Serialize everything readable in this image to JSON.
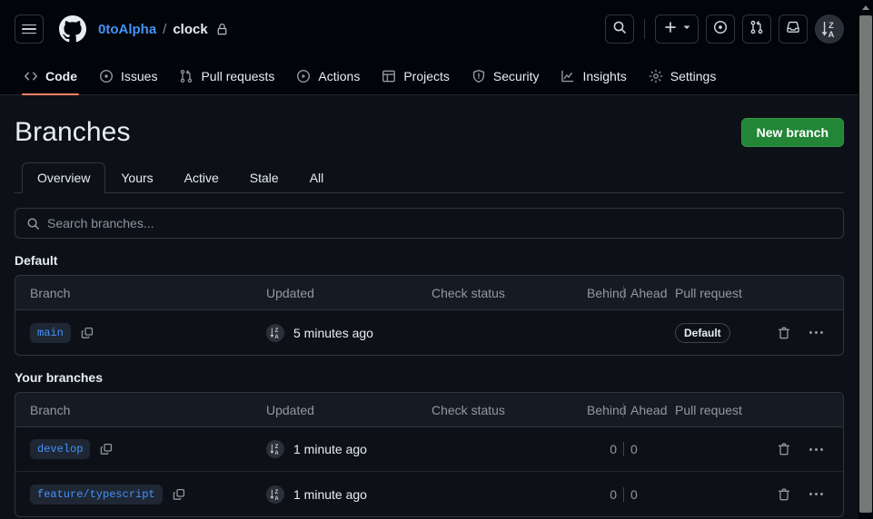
{
  "header": {
    "menu_label": "Open menu",
    "logo": "github-logo",
    "breadcrumb": {
      "owner": "0toAlpha",
      "separator": "/",
      "repo": "clock",
      "visibility_icon": "lock-icon"
    },
    "actions": [
      {
        "name": "search-button",
        "icon": "search-icon"
      },
      {
        "name": "create-new-button",
        "icon": "plus-icon",
        "caret": "chevron-down-icon"
      },
      {
        "name": "issues-button",
        "icon": "issue-opened-icon"
      },
      {
        "name": "pull-requests-button",
        "icon": "git-pull-request-icon"
      },
      {
        "name": "notifications-button",
        "icon": "inbox-icon"
      },
      {
        "name": "user-avatar",
        "icon": "sort-za-icon"
      }
    ]
  },
  "repo_nav": {
    "items": [
      {
        "label": "Code",
        "icon": "code-icon",
        "active": true
      },
      {
        "label": "Issues",
        "icon": "issue-opened-icon",
        "active": false
      },
      {
        "label": "Pull requests",
        "icon": "git-pull-request-icon",
        "active": false
      },
      {
        "label": "Actions",
        "icon": "play-icon",
        "active": false
      },
      {
        "label": "Projects",
        "icon": "table-icon",
        "active": false
      },
      {
        "label": "Security",
        "icon": "shield-icon",
        "active": false
      },
      {
        "label": "Insights",
        "icon": "graph-icon",
        "active": false
      },
      {
        "label": "Settings",
        "icon": "gear-icon",
        "active": false
      }
    ]
  },
  "main": {
    "title": "Branches",
    "new_branch_label": "New branch",
    "tabs": [
      {
        "label": "Overview",
        "selected": true
      },
      {
        "label": "Yours",
        "selected": false
      },
      {
        "label": "Active",
        "selected": false
      },
      {
        "label": "Stale",
        "selected": false
      },
      {
        "label": "All",
        "selected": false
      }
    ],
    "search": {
      "placeholder": "Search branches...",
      "value": "",
      "icon": "search-icon"
    },
    "columns": {
      "branch": "Branch",
      "updated": "Updated",
      "check_status": "Check status",
      "behind": "Behind",
      "ahead": "Ahead",
      "pull_request": "Pull request"
    },
    "sections": [
      {
        "heading": "Default",
        "rows": [
          {
            "branch": "main",
            "copy_icon": "copy-icon",
            "updated": "5 minutes ago",
            "avatar": "sort-za-icon",
            "check_status": "",
            "behind": "",
            "ahead": "",
            "pull_request": "Default",
            "is_default": true,
            "delete_icon": "trash-icon",
            "more_icon": "kebab-horizontal-icon"
          }
        ]
      },
      {
        "heading": "Your branches",
        "rows": [
          {
            "branch": "develop",
            "copy_icon": "copy-icon",
            "updated": "1 minute ago",
            "avatar": "sort-za-icon",
            "check_status": "",
            "behind": "0",
            "ahead": "0",
            "pull_request": "",
            "is_default": false,
            "delete_icon": "trash-icon",
            "more_icon": "kebab-horizontal-icon"
          },
          {
            "branch": "feature/typescript",
            "copy_icon": "copy-icon",
            "updated": "1 minute ago",
            "avatar": "sort-za-icon",
            "check_status": "",
            "behind": "0",
            "ahead": "0",
            "pull_request": "",
            "is_default": false,
            "delete_icon": "trash-icon",
            "more_icon": "kebab-horizontal-icon"
          }
        ]
      }
    ]
  },
  "colors": {
    "accent_blue": "#4493f8",
    "success_green": "#238636",
    "active_tab_underline": "#f78166",
    "canvas": "#0d1117",
    "header_bg": "#010409",
    "border": "#30363d"
  }
}
